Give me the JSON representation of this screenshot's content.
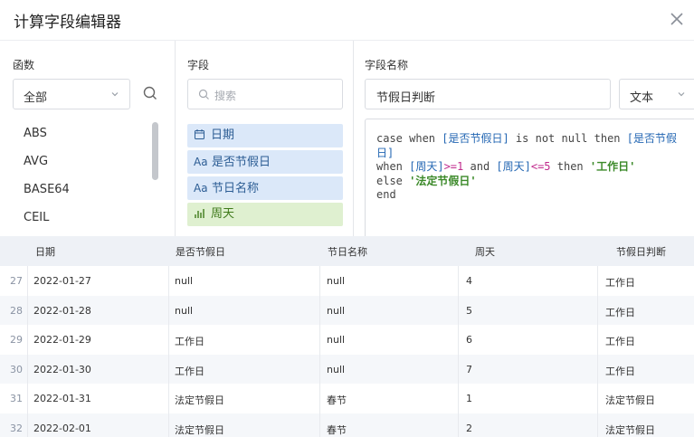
{
  "dialog": {
    "title": "计算字段编辑器",
    "close_icon": "close-icon"
  },
  "functions_panel": {
    "label": "函数",
    "category_select": "全部",
    "items": [
      "ABS",
      "AVG",
      "BASE64",
      "CEIL"
    ]
  },
  "fields_panel": {
    "label": "字段",
    "search_placeholder": "搜索",
    "items": [
      {
        "type_icon": "date-icon",
        "name": "日期",
        "kind": "text"
      },
      {
        "type_icon": "Aa",
        "name": "是否节假日",
        "kind": "text"
      },
      {
        "type_icon": "Aa",
        "name": "节日名称",
        "kind": "text"
      },
      {
        "type_icon": "bar-chart-icon",
        "name": "周天",
        "kind": "num"
      }
    ]
  },
  "editor_panel": {
    "label": "字段名称",
    "field_name": "节假日判断",
    "type_select": "文本",
    "code": {
      "case": "case when ",
      "f1": "[是否节假日]",
      "isnn": " is not null then ",
      "f2": "[是否节假",
      "f2b": "日]",
      "when": "when ",
      "f3": "[周天]",
      "ge": ">=",
      "n1": "1",
      "and": " and ",
      "f4": "[周天]",
      "le": "<=",
      "n5": "5",
      "then": " then ",
      "s1": "'工作日'",
      "else": "else ",
      "s2": "'法定节假日'",
      "end": "end"
    }
  },
  "table": {
    "headers": [
      "日期",
      "是否节假日",
      "节日名称",
      "周天",
      "节假日判断"
    ],
    "rows": [
      {
        "idx": "27",
        "cells": [
          "2022-01-27",
          "null",
          "null",
          "4",
          "工作日"
        ]
      },
      {
        "idx": "28",
        "cells": [
          "2022-01-28",
          "null",
          "null",
          "5",
          "工作日"
        ]
      },
      {
        "idx": "29",
        "cells": [
          "2022-01-29",
          "工作日",
          "null",
          "6",
          "工作日"
        ]
      },
      {
        "idx": "30",
        "cells": [
          "2022-01-30",
          "工作日",
          "null",
          "7",
          "工作日"
        ]
      },
      {
        "idx": "31",
        "cells": [
          "2022-01-31",
          "法定节假日",
          "春节",
          "1",
          "法定节假日"
        ]
      },
      {
        "idx": "32",
        "cells": [
          "2022-02-01",
          "法定节假日",
          "春节",
          "2",
          "法定节假日"
        ]
      }
    ]
  }
}
